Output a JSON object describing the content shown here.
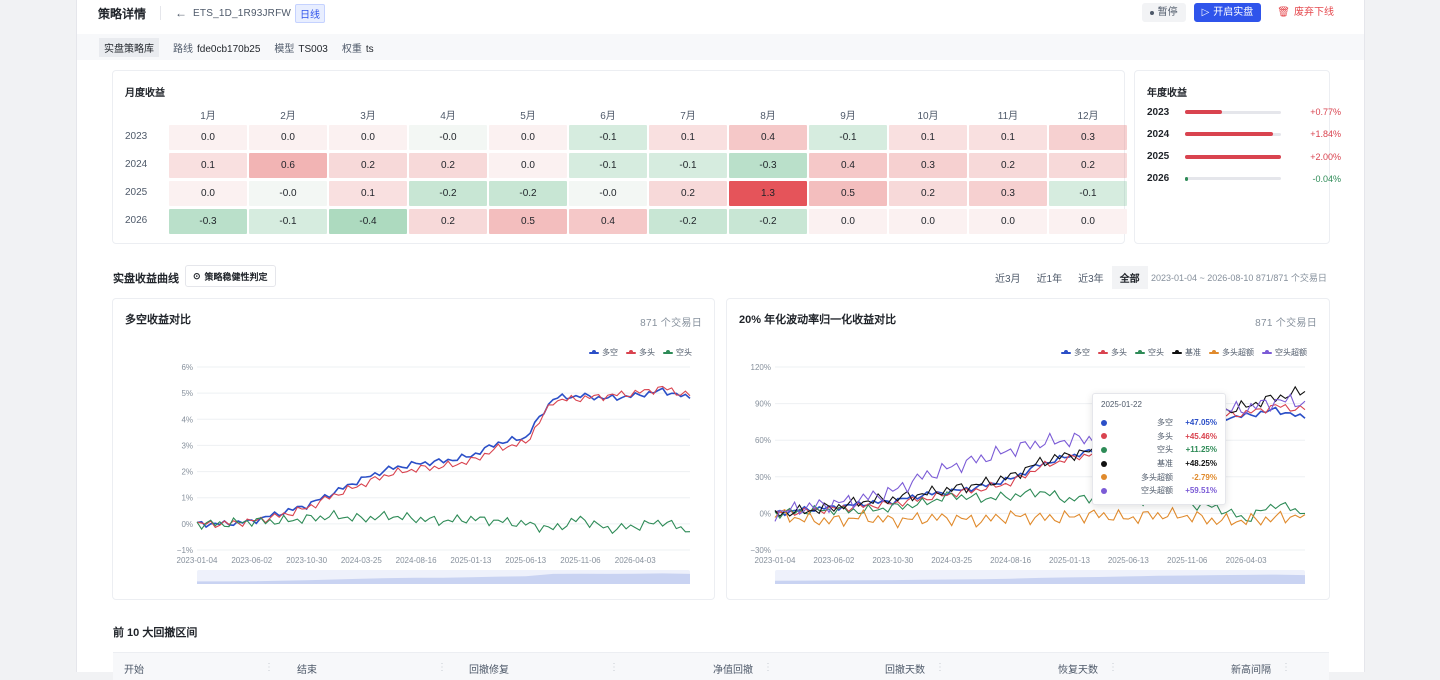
{
  "header": {
    "title": "策略详情",
    "back_icon": "←",
    "code": "ETS_1D_1R93JRFW",
    "freq_tag": "日线",
    "buttons": {
      "pause": "暂停",
      "start_live": "开启实盘",
      "discard": "废弃下线"
    }
  },
  "subbar": {
    "chip": "实盘策略库",
    "path_label": "路线",
    "path_value": "fde0cb170b25",
    "model_label": "模型",
    "model_value": "TS003",
    "weight_label": "权重",
    "weight_value": "ts"
  },
  "monthly": {
    "title": "月度收益",
    "months": [
      "1月",
      "2月",
      "3月",
      "4月",
      "5月",
      "6月",
      "7月",
      "8月",
      "9月",
      "10月",
      "11月",
      "12月"
    ],
    "rows": [
      {
        "year": "2023",
        "values": [
          "0.0",
          "0.0",
          "0.0",
          "-0.0",
          "0.0",
          "-0.1",
          "0.1",
          "0.4",
          "-0.1",
          "0.1",
          "0.1",
          "0.3"
        ]
      },
      {
        "year": "2024",
        "values": [
          "0.1",
          "0.6",
          "0.2",
          "0.2",
          "0.0",
          "-0.1",
          "-0.1",
          "-0.3",
          "0.4",
          "0.3",
          "0.2",
          "0.2"
        ]
      },
      {
        "year": "2025",
        "values": [
          "0.0",
          "-0.0",
          "0.1",
          "-0.2",
          "-0.2",
          "-0.0",
          "0.2",
          "1.3",
          "0.5",
          "0.2",
          "0.3",
          "-0.1"
        ]
      },
      {
        "year": "2026",
        "values": [
          "-0.3",
          "-0.1",
          "-0.4",
          "0.2",
          "0.5",
          "0.4",
          "-0.2",
          "-0.2",
          "0.0",
          "0.0",
          "0.0",
          "0.0"
        ]
      }
    ]
  },
  "yearly": {
    "title": "年度收益",
    "rows": [
      {
        "year": "2023",
        "pct": "+0.77%",
        "value": 0.77
      },
      {
        "year": "2024",
        "pct": "+1.84%",
        "value": 1.84
      },
      {
        "year": "2025",
        "pct": "+2.00%",
        "value": 2.0
      },
      {
        "year": "2026",
        "pct": "-0.04%",
        "value": -0.04
      }
    ],
    "max_value": 2.0
  },
  "curve_section": {
    "title": "实盘收益曲线",
    "robust_button": "策略稳健性判定",
    "robust_icon": "⊙",
    "ranges": [
      "近3月",
      "近1年",
      "近3年",
      "全部"
    ],
    "active_range": "全部",
    "range_info": "2023-01-04 ~ 2026-08-10  871/871 个交易日"
  },
  "colors": {
    "longshort": "#2b4fc7",
    "long": "#d9434f",
    "short": "#2e8b57",
    "bench": "#111111",
    "long_excess": "#e08a2c",
    "short_excess": "#7b5bd6",
    "pos_text": "#d9434f",
    "neg_text": "#2e8b57"
  },
  "chart_data": [
    {
      "type": "line",
      "title": "多空收益对比",
      "days_label": "871 个交易日",
      "x": [
        "2023-01-04",
        "2023-03-20",
        "2023-06-02",
        "2023-08-18",
        "2023-10-30",
        "2024-01-10",
        "2024-03-25",
        "2024-06-05",
        "2024-08-16",
        "2024-10-30",
        "2025-01-13",
        "2025-03-28",
        "2025-06-13",
        "2025-08-28",
        "2025-11-06",
        "2026-01-20",
        "2026-04-03",
        "2026-06-18",
        "2026-08-10"
      ],
      "x_ticks": [
        "2023-01-04",
        "2023-06-02",
        "2023-10-30",
        "2024-03-25",
        "2024-08-16",
        "2025-01-13",
        "2025-06-13",
        "2025-11-06",
        "2026-04-03"
      ],
      "y_ticks": [
        "6%",
        "5%",
        "4%",
        "3%",
        "2%",
        "1%",
        "0%",
        "−1%"
      ],
      "ylim": [
        -1,
        6
      ],
      "series": [
        {
          "name": "多空",
          "color_key": "longshort",
          "values": [
            0.0,
            0.0,
            0.1,
            0.4,
            0.7,
            1.2,
            1.7,
            2.1,
            2.3,
            2.4,
            2.6,
            3.1,
            3.3,
            4.8,
            4.9,
            4.8,
            4.9,
            5.1,
            4.8
          ]
        },
        {
          "name": "多头",
          "color_key": "long",
          "values": [
            0.0,
            0.0,
            0.1,
            0.3,
            0.6,
            1.1,
            1.5,
            1.9,
            2.1,
            2.2,
            2.4,
            2.9,
            3.1,
            4.7,
            4.8,
            4.9,
            5.0,
            5.2,
            4.9
          ]
        },
        {
          "name": "空头",
          "color_key": "short",
          "values": [
            0.0,
            0.0,
            0.1,
            0.1,
            0.2,
            0.3,
            0.2,
            0.3,
            0.2,
            0.1,
            0.2,
            0.1,
            0.0,
            -0.2,
            0.2,
            -0.2,
            -0.1,
            0.1,
            -0.3
          ]
        }
      ]
    },
    {
      "type": "line",
      "title": "20% 年化波动率归一化收益对比",
      "days_label": "871 个交易日",
      "x": [
        "2023-01-04",
        "2023-03-20",
        "2023-06-02",
        "2023-08-18",
        "2023-10-30",
        "2024-01-10",
        "2024-03-25",
        "2024-06-05",
        "2024-08-16",
        "2024-10-30",
        "2025-01-13",
        "2025-03-28",
        "2025-06-13",
        "2025-08-28",
        "2025-11-06",
        "2026-01-20",
        "2026-04-03",
        "2026-06-18",
        "2026-08-10"
      ],
      "x_ticks": [
        "2023-01-04",
        "2023-06-02",
        "2023-10-30",
        "2024-03-25",
        "2024-08-16",
        "2025-01-13",
        "2025-06-13",
        "2025-11-06",
        "2026-04-03"
      ],
      "y_ticks": [
        "120%",
        "90%",
        "60%",
        "30%",
        "0%",
        "−30%"
      ],
      "ylim": [
        -30,
        120
      ],
      "series": [
        {
          "name": "多空",
          "color_key": "longshort",
          "values": [
            0,
            3,
            5,
            8,
            10,
            15,
            18,
            22,
            28,
            40,
            47,
            52,
            60,
            68,
            72,
            78,
            80,
            85,
            78
          ]
        },
        {
          "name": "多头",
          "color_key": "long",
          "values": [
            0,
            2,
            4,
            6,
            8,
            12,
            16,
            20,
            25,
            38,
            45,
            50,
            62,
            70,
            76,
            80,
            82,
            88,
            85
          ]
        },
        {
          "name": "空头",
          "color_key": "short",
          "values": [
            0,
            2,
            3,
            2,
            5,
            8,
            15,
            12,
            14,
            18,
            11,
            14,
            10,
            12,
            8,
            5,
            -5,
            8,
            0
          ]
        },
        {
          "name": "基准",
          "color_key": "bench",
          "values": [
            0,
            2,
            5,
            10,
            12,
            16,
            20,
            24,
            30,
            42,
            48,
            52,
            62,
            72,
            78,
            82,
            88,
            95,
            100
          ]
        },
        {
          "name": "多头超额",
          "color_key": "long_excess",
          "values": [
            0,
            -5,
            -6,
            -3,
            -6,
            -4,
            -4,
            -6,
            -2,
            -4,
            -3,
            -1,
            -4,
            -1,
            -2,
            -6,
            -6,
            -4,
            -1
          ]
        },
        {
          "name": "空头超额",
          "color_key": "short_excess",
          "values": [
            0,
            5,
            8,
            12,
            18,
            30,
            38,
            45,
            52,
            58,
            60,
            62,
            66,
            74,
            80,
            84,
            86,
            92,
            92
          ]
        }
      ]
    }
  ],
  "tooltip": {
    "date": "2025-01-22",
    "rows": [
      {
        "name": "多空",
        "value": "+47.05%",
        "color_key": "longshort"
      },
      {
        "name": "多头",
        "value": "+45.46%",
        "color_key": "long"
      },
      {
        "name": "空头",
        "value": "+11.25%",
        "color_key": "short"
      },
      {
        "name": "基准",
        "value": "+48.25%",
        "color_key": "bench"
      },
      {
        "name": "多头超额",
        "value": "-2.79%",
        "color_key": "long_excess"
      },
      {
        "name": "空头超额",
        "value": "+59.51%",
        "color_key": "short_excess"
      }
    ]
  },
  "drawdown": {
    "title": "前 10 大回撤区间",
    "columns": [
      "开始",
      "结束",
      "回撤修复",
      "净值回撤",
      "回撤天数",
      "恢复天数",
      "新高间隔"
    ]
  }
}
